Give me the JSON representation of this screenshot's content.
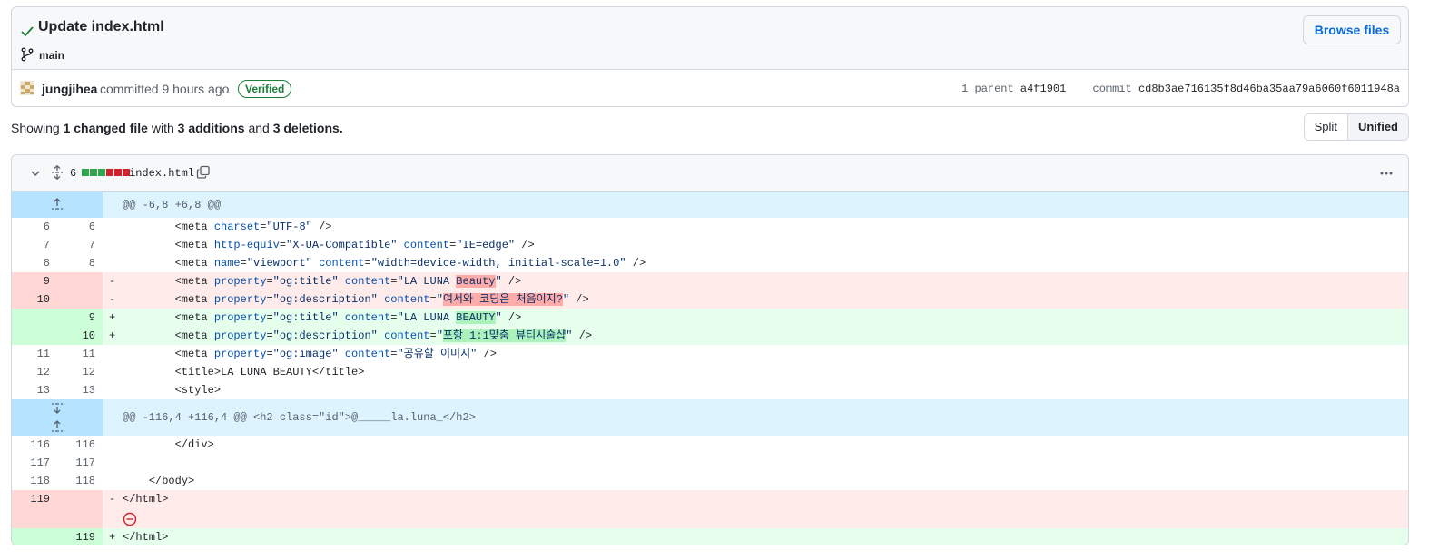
{
  "commit": {
    "title": "Update index.html",
    "branch": "main",
    "browse_label": "Browse files",
    "author": "jungjihea",
    "committed_text": "committed 9 hours ago",
    "verified_label": "Verified",
    "parent_label": "1 parent",
    "parent_sha": "a4f1901",
    "commit_label": "commit",
    "commit_sha": "cd8b3ae716135f8d46ba35aa79a6060f6011948a"
  },
  "summary": {
    "showing": "Showing",
    "changed": "1 changed file",
    "with": "with",
    "additions": "3 additions",
    "and": "and",
    "deletions": "3 deletions."
  },
  "view_toggle": {
    "split": "Split",
    "unified": "Unified"
  },
  "file": {
    "change_count": "6",
    "name": "index.html",
    "blocks": [
      "#2da44e",
      "#2da44e",
      "#2da44e",
      "#cf222e",
      "#cf222e",
      "#cf222e",
      "#eaeef2"
    ]
  },
  "diff": {
    "hunk1": "@@ -6,8 +6,8 @@",
    "hunk2": "@@ -116,4 +116,4 @@ <h2 class=\"id\">@_____la.luna_</h2>",
    "lines": {
      "l6": {
        "old": "6",
        "new": "6"
      },
      "l7": {
        "old": "7",
        "new": "7"
      },
      "l8": {
        "old": "8",
        "new": "8"
      },
      "d9": {
        "old": "9",
        "mark": "-"
      },
      "d10": {
        "old": "10",
        "mark": "-"
      },
      "a9": {
        "new": "9",
        "mark": "+"
      },
      "a10": {
        "new": "10",
        "mark": "+"
      },
      "l11": {
        "old": "11",
        "new": "11"
      },
      "l12": {
        "old": "12",
        "new": "12"
      },
      "l13": {
        "old": "13",
        "new": "13"
      },
      "l116": {
        "old": "116",
        "new": "116"
      },
      "l117": {
        "old": "117",
        "new": "117"
      },
      "l118": {
        "old": "118",
        "new": "118"
      },
      "d119": {
        "old": "119",
        "mark": "-"
      },
      "a119": {
        "new": "119",
        "mark": "+"
      }
    },
    "tokens": {
      "indent8": "        ",
      "indent4": "    ",
      "meta_open": "<meta ",
      "attr_charset": "charset",
      "attr_http": "http-equiv",
      "attr_content": "content",
      "attr_name": "name",
      "attr_property": "property",
      "eq": "=",
      "space": " ",
      "close": " />",
      "q": "\"",
      "v_utf8": "\"UTF-8\"",
      "v_xua": "\"X-UA-Compatible\"",
      "v_ie": "\"IE=edge\"",
      "v_viewport": "\"viewport\"",
      "v_width": "\"width=device-width, initial-scale=1.0\"",
      "v_ogtitle": "\"og:title\"",
      "v_ogdesc": "\"og:description\"",
      "v_ogimage": "\"og:image\"",
      "v_laluna": "LA LUNA ",
      "v_beauty_old": "Beauty",
      "v_beauty_new": "BEAUTY",
      "v_desc_old": "여서와 코딩은 처음이지?",
      "v_desc_new": "포항 1:1맞춤 뷰티시술샵",
      "v_image": "\"공유할 이미지\"",
      "title_line": "<title>LA LUNA BEAUTY</title>",
      "style_line": "<style>",
      "div_close": "</div>",
      "body_close": "</body>",
      "html_close": "</html>"
    }
  }
}
